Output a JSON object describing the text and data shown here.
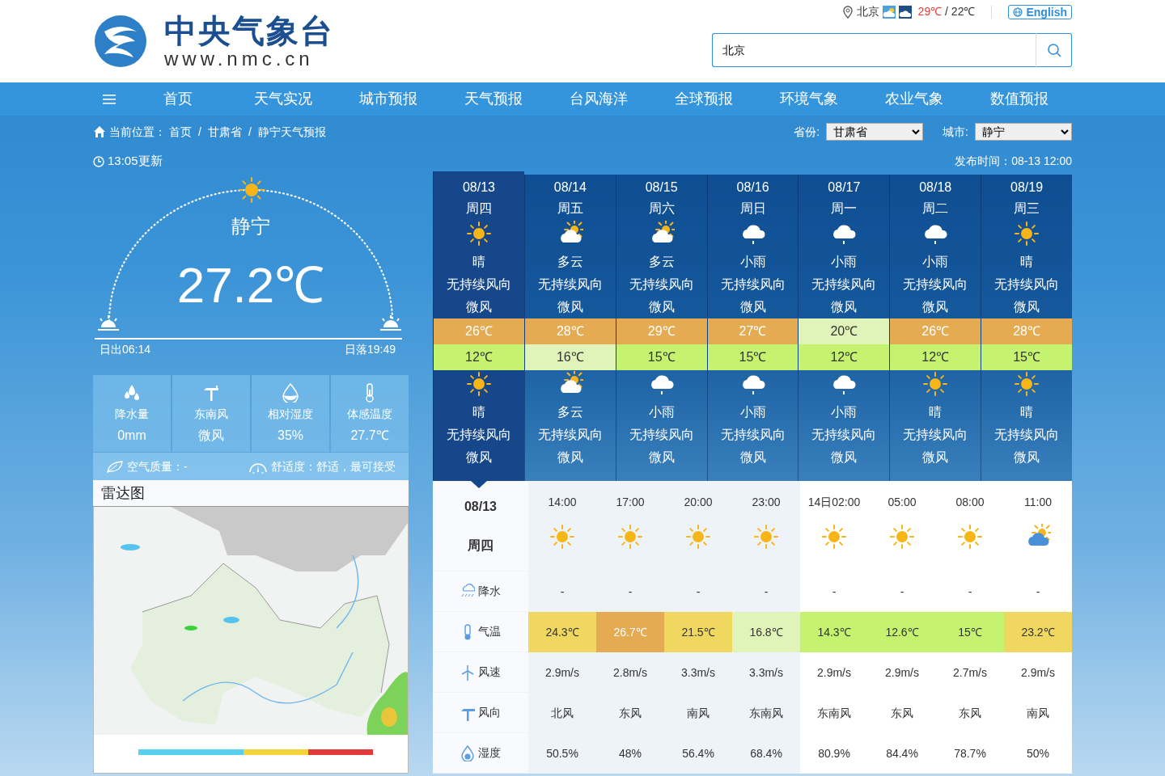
{
  "logo": {
    "title": "中央气象台",
    "url": "www.nmc.cn"
  },
  "top_bar": {
    "city": "北京",
    "high": "29℃",
    "separator": "/",
    "low": "22℃",
    "language": "English"
  },
  "search": {
    "value": "北京"
  },
  "nav": {
    "items": [
      "首页",
      "天气实况",
      "城市预报",
      "天气预报",
      "台风海洋",
      "全球预报",
      "环境气象",
      "农业气象",
      "数值预报"
    ]
  },
  "breadcrumb": {
    "label": "当前位置：",
    "separator": "/",
    "items": [
      "首页",
      "甘肃省",
      "静宁天气预报"
    ]
  },
  "selectors": [
    {
      "label": "省份:",
      "value": "甘肃省"
    },
    {
      "label": "城市:",
      "value": "静宁"
    }
  ],
  "update_time": "13:05更新",
  "publish_time": "发布时间：08-13 12:00",
  "current": {
    "city": "静宁",
    "temperature": "27.2℃",
    "sunrise": "日出06:14",
    "sunset": "日落19:49"
  },
  "stats": [
    {
      "kind": "precipitation",
      "label": "降水量",
      "value": "0mm"
    },
    {
      "kind": "wind",
      "label": "东南风",
      "value": "微风"
    },
    {
      "kind": "humidity",
      "label": "相对湿度",
      "value": "35%"
    },
    {
      "kind": "feels_like",
      "label": "体感温度",
      "value": "27.7℃"
    }
  ],
  "air_quality": "空气质量：-",
  "comfort": "舒适度：舒适，最可接受",
  "radar": {
    "title": "雷达图",
    "kind": "picture"
  },
  "days": [
    {
      "date": "08/13",
      "weekday": "周四",
      "selected": true,
      "day": {
        "kind": "sunny",
        "weather": "晴",
        "wind": "无持续风向",
        "power": "微风"
      },
      "high": {
        "text": "26℃",
        "color": "#e5ab52"
      },
      "low": {
        "text": "12℃",
        "color": "#c5f370"
      },
      "night": {
        "kind": "sunny",
        "weather": "晴",
        "wind": "无持续风向",
        "power": "微风"
      }
    },
    {
      "date": "08/14",
      "weekday": "周五",
      "selected": false,
      "day": {
        "kind": "partly_cloudy",
        "weather": "多云",
        "wind": "无持续风向",
        "power": "微风"
      },
      "high": {
        "text": "28℃",
        "color": "#e5ab52"
      },
      "low": {
        "text": "16℃",
        "color": "#e0f3b8"
      },
      "night": {
        "kind": "partly_cloudy",
        "weather": "多云",
        "wind": "无持续风向",
        "power": "微风"
      }
    },
    {
      "date": "08/15",
      "weekday": "周六",
      "selected": false,
      "day": {
        "kind": "partly_cloudy",
        "weather": "多云",
        "wind": "无持续风向",
        "power": "微风"
      },
      "high": {
        "text": "29℃",
        "color": "#e5ab52"
      },
      "low": {
        "text": "15℃",
        "color": "#c5f370"
      },
      "night": {
        "kind": "rain",
        "weather": "小雨",
        "wind": "无持续风向",
        "power": "微风"
      }
    },
    {
      "date": "08/16",
      "weekday": "周日",
      "selected": false,
      "day": {
        "kind": "rain",
        "weather": "小雨",
        "wind": "无持续风向",
        "power": "微风"
      },
      "high": {
        "text": "27℃",
        "color": "#e5ab52"
      },
      "low": {
        "text": "15℃",
        "color": "#c5f370"
      },
      "night": {
        "kind": "rain",
        "weather": "小雨",
        "wind": "无持续风向",
        "power": "微风"
      }
    },
    {
      "date": "08/17",
      "weekday": "周一",
      "selected": false,
      "day": {
        "kind": "rain",
        "weather": "小雨",
        "wind": "无持续风向",
        "power": "微风"
      },
      "high": {
        "text": "20℃",
        "color": "#e0f3b8"
      },
      "low": {
        "text": "12℃",
        "color": "#c5f370"
      },
      "night": {
        "kind": "rain",
        "weather": "小雨",
        "wind": "无持续风向",
        "power": "微风"
      }
    },
    {
      "date": "08/18",
      "weekday": "周二",
      "selected": false,
      "day": {
        "kind": "rain",
        "weather": "小雨",
        "wind": "无持续风向",
        "power": "微风"
      },
      "high": {
        "text": "26℃",
        "color": "#e5ab52"
      },
      "low": {
        "text": "12℃",
        "color": "#c5f370"
      },
      "night": {
        "kind": "sunny",
        "weather": "晴",
        "wind": "无持续风向",
        "power": "微风"
      }
    },
    {
      "date": "08/19",
      "weekday": "周三",
      "selected": false,
      "day": {
        "kind": "sunny",
        "weather": "晴",
        "wind": "无持续风向",
        "power": "微风"
      },
      "high": {
        "text": "28℃",
        "color": "#e5ab52"
      },
      "low": {
        "text": "15℃",
        "color": "#c5f370"
      },
      "night": {
        "kind": "sunny",
        "weather": "晴",
        "wind": "无持续风向",
        "power": "微风"
      }
    }
  ],
  "hourly": {
    "date": "08/13",
    "weekday": "周四",
    "rows": [
      {
        "kind": "precipitation",
        "label": "降水"
      },
      {
        "kind": "temperature",
        "label": "气温"
      },
      {
        "kind": "wind_speed",
        "label": "风速"
      },
      {
        "kind": "wind_direction",
        "label": "风向"
      },
      {
        "kind": "humidity",
        "label": "湿度"
      }
    ],
    "columns": [
      {
        "time": "14:00",
        "today": true,
        "kind": "sunny",
        "precipitation": "-",
        "temperature": "24.3℃",
        "color": "#f0d860",
        "wind_speed": "2.9m/s",
        "wind_direction": "北风",
        "humidity": "50.5%"
      },
      {
        "time": "17:00",
        "today": true,
        "kind": "sunny",
        "precipitation": "-",
        "temperature": "26.7℃",
        "color": "#e5ab52",
        "wind_speed": "2.8m/s",
        "wind_direction": "东风",
        "humidity": "48%"
      },
      {
        "time": "20:00",
        "today": true,
        "kind": "sunny",
        "precipitation": "-",
        "temperature": "21.5℃",
        "color": "#f0d860",
        "wind_speed": "3.3m/s",
        "wind_direction": "南风",
        "humidity": "56.4%"
      },
      {
        "time": "23:00",
        "today": true,
        "kind": "sunny",
        "precipitation": "-",
        "temperature": "16.8℃",
        "color": "#e0f3b8",
        "wind_speed": "3.3m/s",
        "wind_direction": "东南风",
        "humidity": "68.4%"
      },
      {
        "time": "14日02:00",
        "today": false,
        "kind": "sunny",
        "precipitation": "-",
        "temperature": "14.3℃",
        "color": "#c5f370",
        "wind_speed": "2.9m/s",
        "wind_direction": "东南风",
        "humidity": "80.9%"
      },
      {
        "time": "05:00",
        "today": false,
        "kind": "sunny",
        "precipitation": "-",
        "temperature": "12.6℃",
        "color": "#c5f370",
        "wind_speed": "2.9m/s",
        "wind_direction": "东风",
        "humidity": "84.4%"
      },
      {
        "time": "08:00",
        "today": false,
        "kind": "sunny",
        "precipitation": "-",
        "temperature": "15℃",
        "color": "#c5f370",
        "wind_speed": "2.7m/s",
        "wind_direction": "东风",
        "humidity": "78.7%"
      },
      {
        "time": "11:00",
        "today": false,
        "kind": "partly_cloudy",
        "precipitation": "-",
        "temperature": "23.2℃",
        "color": "#f0d860",
        "wind_speed": "2.9m/s",
        "wind_direction": "南风",
        "humidity": "50%"
      }
    ]
  }
}
